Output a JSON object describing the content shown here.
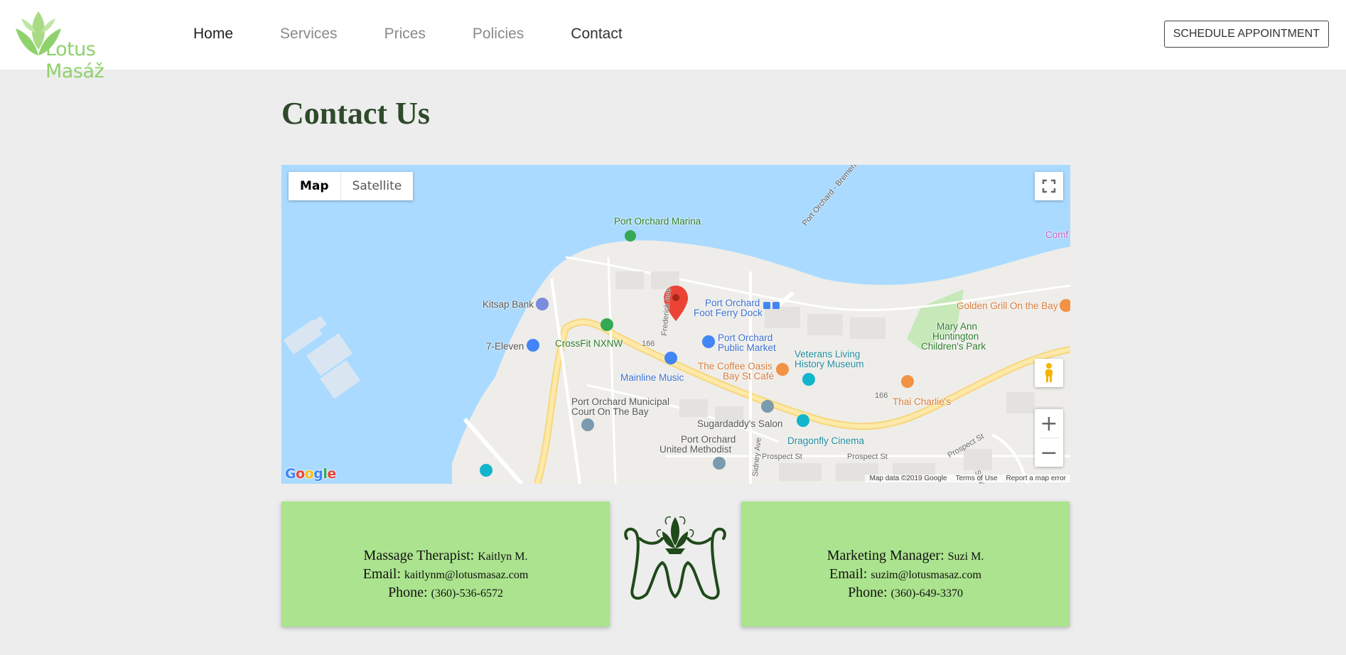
{
  "header": {
    "logo_text": "Lotus Masáž",
    "nav": [
      {
        "label": "Home"
      },
      {
        "label": "Services"
      },
      {
        "label": "Prices"
      },
      {
        "label": "Policies"
      },
      {
        "label": "Contact"
      }
    ],
    "schedule_label": "SCHEDULE APPOINTMENT"
  },
  "page_title": "Contact Us",
  "map": {
    "toggle": {
      "map": "Map",
      "satellite": "Satellite"
    },
    "places": {
      "marina": "Port Orchard Marina",
      "ferry_route": "Port Orchard - Bremerton Foot Fer...",
      "comf": "Comf",
      "kitsap": "Kitsap Bank",
      "frederick": "Frederick Ave",
      "ferry_dock_1": "Port Orchard",
      "ferry_dock_2": "Foot Ferry Dock",
      "golden_grill": "Golden Grill On the Bay",
      "park_1": "Mary Ann",
      "park_2": "Huntington",
      "park_3": "Children's Park",
      "seven_eleven": "7-Eleven",
      "crossfit": "CrossFit NXNW",
      "route_166_a": "166",
      "route_166_b": "166",
      "public_market_1": "Port Orchard",
      "public_market_2": "Public Market",
      "veterans_1": "Veterans Living",
      "veterans_2": "History Museum",
      "coffee_1": "The Coffee Oasis",
      "coffee_2": "Bay St Café",
      "mainline": "Mainline Music",
      "thai": "Thai Charlie's",
      "court_1": "Port Orchard Municipal",
      "court_2": "Court On The Bay",
      "sugardaddy": "Sugardaddy's Salon",
      "dragonfly": "Dragonfly Cinema",
      "methodist_1": "Port Orchard",
      "methodist_2": "United Methodist",
      "sidney": "Sidney Ave",
      "prospect_1": "Prospect St",
      "prospect_2": "Prospect St",
      "prospect_3": "Prospect St",
      "seattle": "Seattle"
    },
    "google": "Google",
    "attribution": {
      "data": "Map data ©2019 Google",
      "terms": "Terms of Use",
      "report": "Report a map error"
    }
  },
  "contacts": [
    {
      "role": "Massage Therapist:",
      "name": "Kaitlyn M.",
      "email_label": "Email:",
      "email": "kaitlynm@lotusmasaz.com",
      "phone_label": "Phone:",
      "phone": "(360)-536-6572"
    },
    {
      "role": "Marketing Manager:",
      "name": "Suzi M.",
      "email_label": "Email:",
      "email": "suzim@lotusmasaz.com",
      "phone_label": "Phone:",
      "phone": "(360)-649-3370"
    }
  ],
  "colors": {
    "brand_green": "#8fd26c",
    "card_green": "#abe38e",
    "title_green": "#2e4a2b",
    "water": "#aadaff"
  }
}
